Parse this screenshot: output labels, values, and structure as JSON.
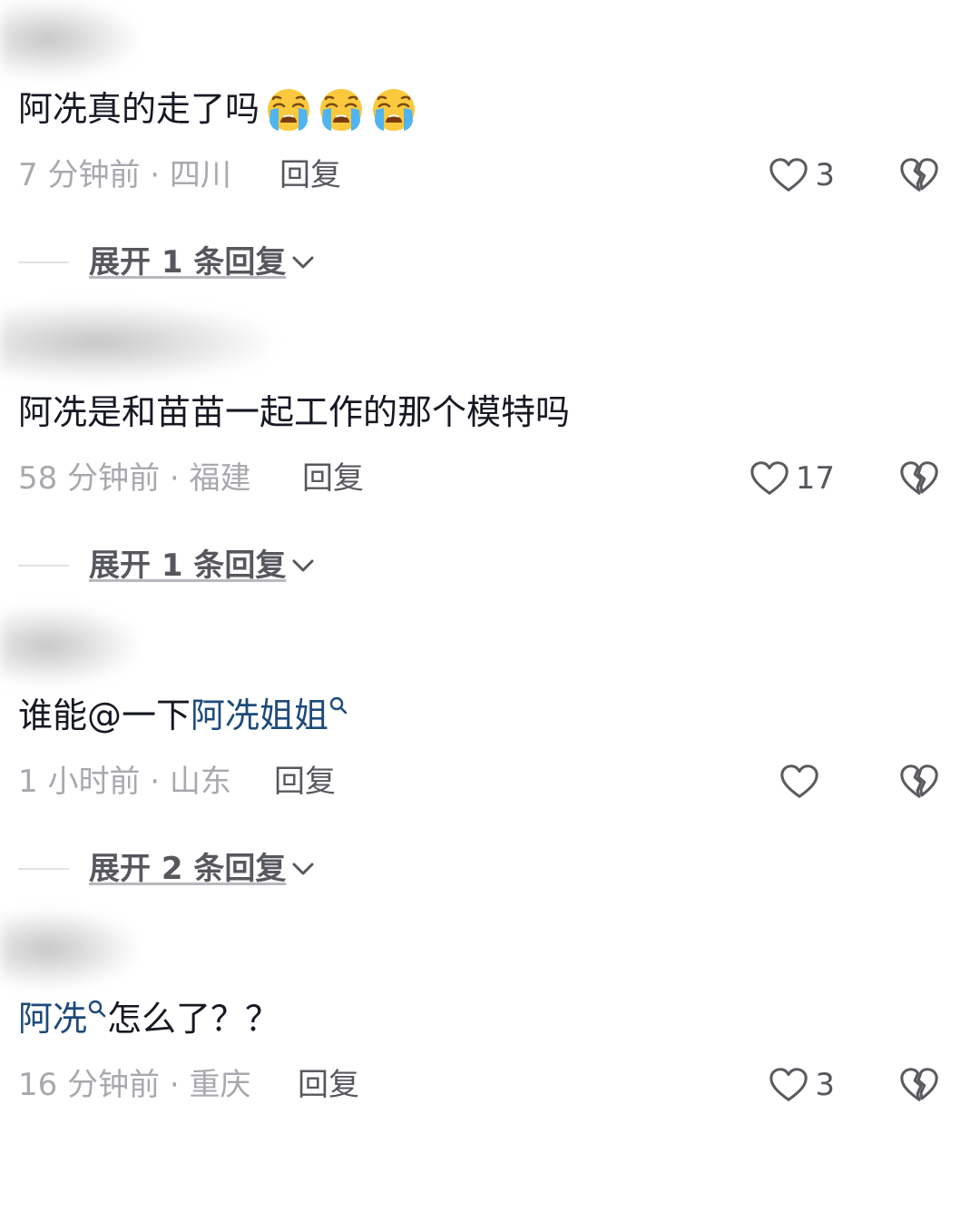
{
  "comments": [
    {
      "text": "阿冼真的走了吗",
      "emoji": [
        "loudly-crying-face",
        "loudly-crying-face",
        "loudly-crying-face"
      ],
      "meta": "7 分钟前 · 四川",
      "reply_label": "回复",
      "likes": "3",
      "expand_label": "展开 1 条回复"
    },
    {
      "text": "阿冼是和苗苗一起工作的那个模特吗",
      "meta": "58 分钟前 · 福建",
      "reply_label": "回复",
      "likes": "17",
      "expand_label": "展开 1 条回复"
    },
    {
      "text_before": "谁能@一下",
      "mention": "阿冼姐姐",
      "meta": "1 小时前 · 山东",
      "reply_label": "回复",
      "likes": "",
      "expand_label": "展开 2 条回复"
    },
    {
      "mention": "阿冼",
      "text_after": "怎么了？？",
      "meta": "16 分钟前 · 重庆",
      "reply_label": "回复",
      "likes": "3"
    }
  ],
  "colors": {
    "text_primary": "#161823",
    "text_meta": "#a8a9ae",
    "text_action": "#57585e",
    "mention": "#1e4a7a"
  }
}
